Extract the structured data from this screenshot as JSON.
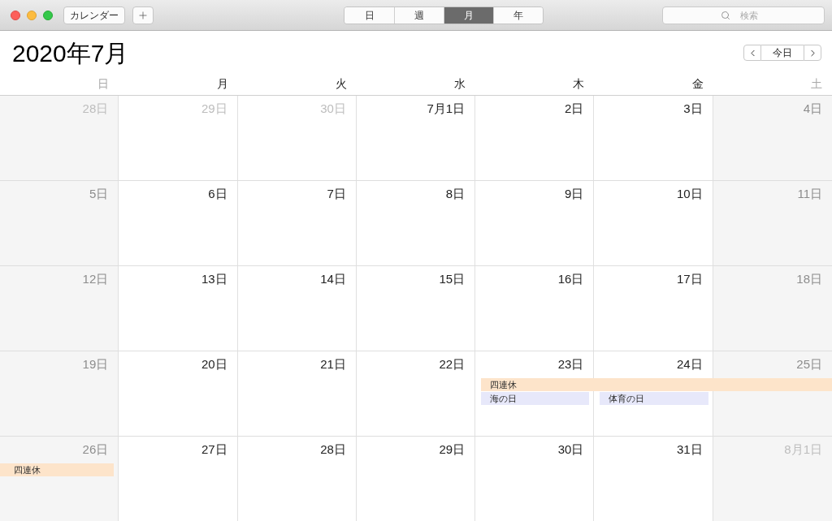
{
  "toolbar": {
    "calendars_button": "カレンダー",
    "view_tabs": [
      {
        "label": "日",
        "selected": false
      },
      {
        "label": "週",
        "selected": false
      },
      {
        "label": "月",
        "selected": true
      },
      {
        "label": "年",
        "selected": false
      }
    ],
    "search": {
      "placeholder": "検索"
    }
  },
  "header": {
    "title": "2020年7月",
    "today_button": "今日"
  },
  "weekdays": [
    {
      "label": "日",
      "weekend": true
    },
    {
      "label": "月",
      "weekend": false
    },
    {
      "label": "火",
      "weekend": false
    },
    {
      "label": "水",
      "weekend": false
    },
    {
      "label": "木",
      "weekend": false
    },
    {
      "label": "金",
      "weekend": false
    },
    {
      "label": "土",
      "weekend": true
    }
  ],
  "weeks": [
    {
      "days": [
        {
          "label": "28日",
          "in_month": false
        },
        {
          "label": "29日",
          "in_month": false
        },
        {
          "label": "30日",
          "in_month": false
        },
        {
          "label": "7月1日",
          "in_month": true
        },
        {
          "label": "2日",
          "in_month": true
        },
        {
          "label": "3日",
          "in_month": true
        },
        {
          "label": "4日",
          "in_month": true
        }
      ]
    },
    {
      "days": [
        {
          "label": "5日",
          "in_month": true
        },
        {
          "label": "6日",
          "in_month": true
        },
        {
          "label": "7日",
          "in_month": true
        },
        {
          "label": "8日",
          "in_month": true
        },
        {
          "label": "9日",
          "in_month": true
        },
        {
          "label": "10日",
          "in_month": true
        },
        {
          "label": "11日",
          "in_month": true
        }
      ]
    },
    {
      "days": [
        {
          "label": "12日",
          "in_month": true
        },
        {
          "label": "13日",
          "in_month": true
        },
        {
          "label": "14日",
          "in_month": true
        },
        {
          "label": "15日",
          "in_month": true
        },
        {
          "label": "16日",
          "in_month": true
        },
        {
          "label": "17日",
          "in_month": true
        },
        {
          "label": "18日",
          "in_month": true
        }
      ]
    },
    {
      "days": [
        {
          "label": "19日",
          "in_month": true
        },
        {
          "label": "20日",
          "in_month": true
        },
        {
          "label": "21日",
          "in_month": true
        },
        {
          "label": "22日",
          "in_month": true
        },
        {
          "label": "23日",
          "in_month": true,
          "events": [
            {
              "title": "四連休",
              "color": "#fde4ca",
              "continues_before": false,
              "continues_after": true
            },
            {
              "title": "海の日",
              "color": "#e7e8fa",
              "continues_before": false,
              "continues_after": false
            }
          ]
        },
        {
          "label": "24日",
          "in_month": true,
          "events": [
            {
              "title": "体育の日",
              "color": "#e7e8fa",
              "continues_before": false,
              "continues_after": false
            }
          ]
        },
        {
          "label": "25日",
          "in_month": true
        }
      ]
    },
    {
      "days": [
        {
          "label": "26日",
          "in_month": true,
          "events": [
            {
              "title": "四連休",
              "color": "#fde4ca",
              "continues_before": true,
              "continues_after": false
            }
          ]
        },
        {
          "label": "27日",
          "in_month": true
        },
        {
          "label": "28日",
          "in_month": true
        },
        {
          "label": "29日",
          "in_month": true
        },
        {
          "label": "30日",
          "in_month": true
        },
        {
          "label": "31日",
          "in_month": true
        },
        {
          "label": "8月1日",
          "in_month": false
        }
      ]
    }
  ]
}
